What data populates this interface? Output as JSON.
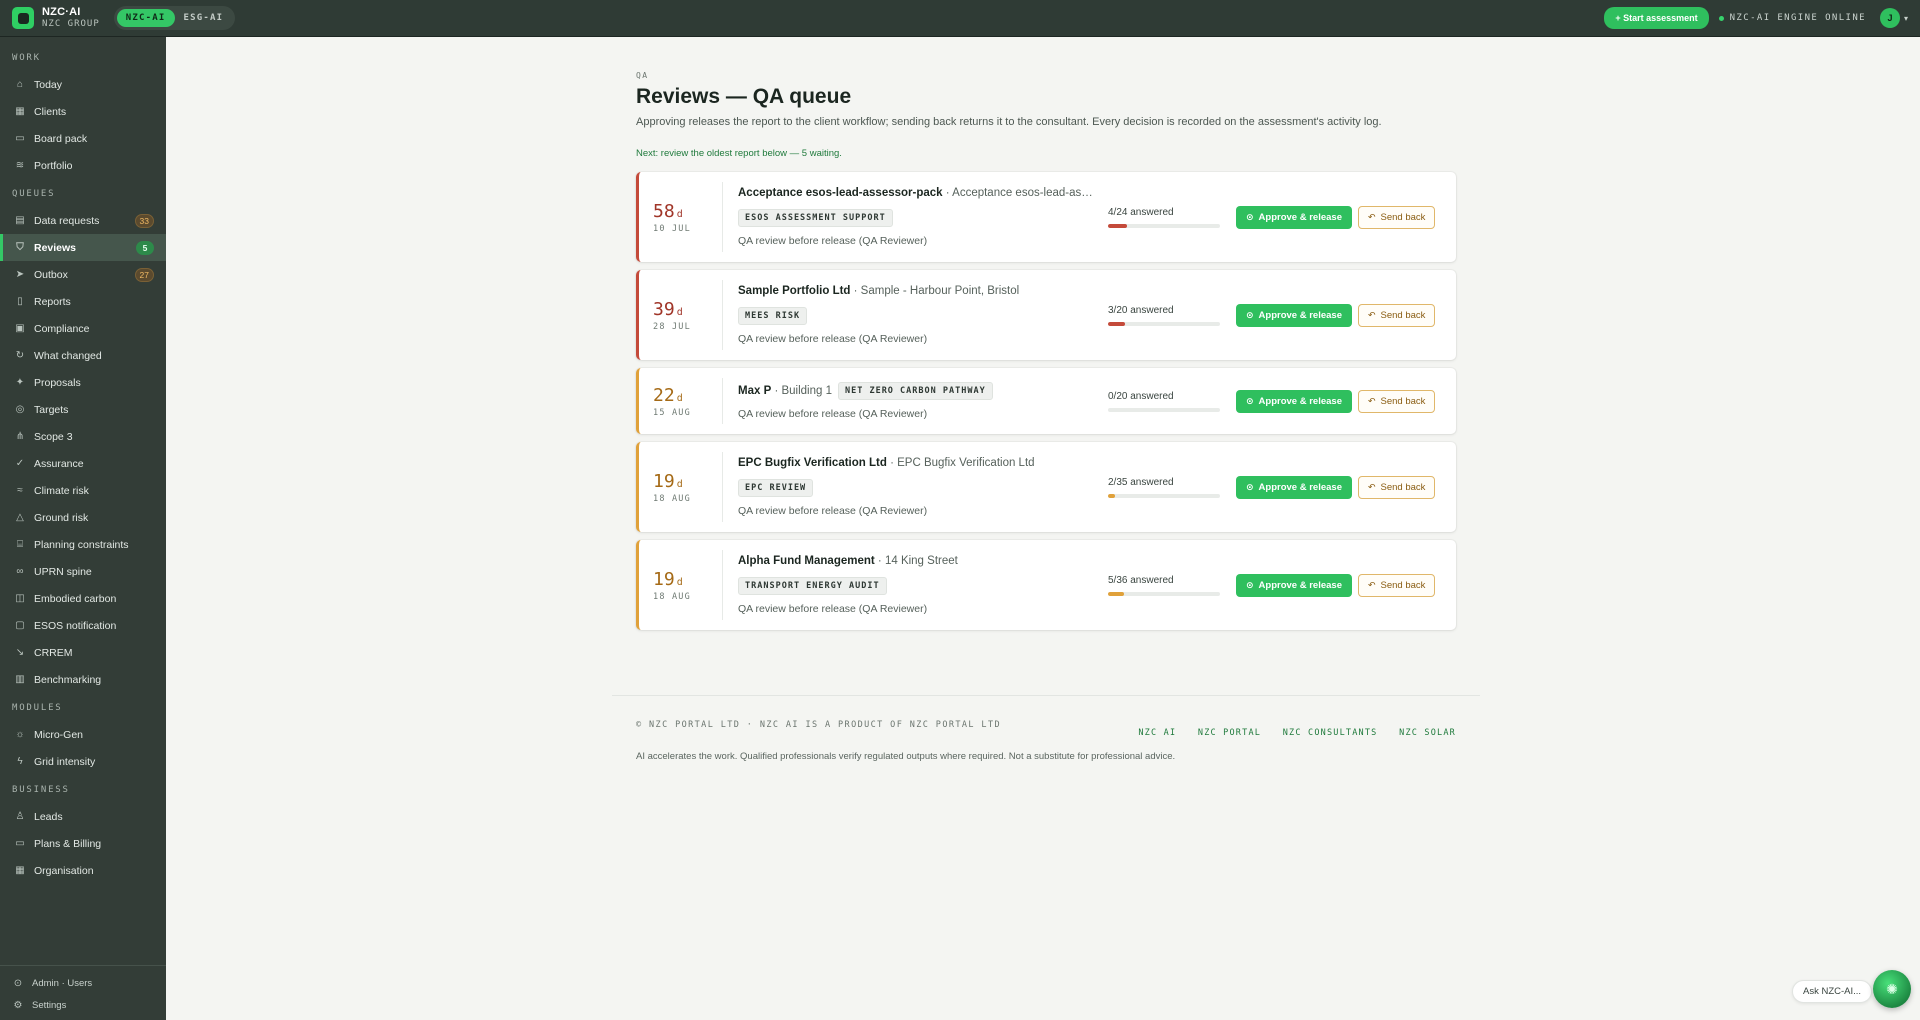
{
  "topbar": {
    "brand_name": "NZC·AI",
    "brand_sub": "NZC GROUP",
    "switch": [
      "NZC-AI",
      "ESG-AI"
    ],
    "start_label": "+ Start assessment",
    "engine_status": "NZC-AI ENGINE ONLINE",
    "avatar_initial": "J"
  },
  "sidebar": {
    "sections": [
      {
        "label": "WORK",
        "items": [
          {
            "label": "Today",
            "icon": "home-icon"
          },
          {
            "label": "Clients",
            "icon": "building-icon"
          },
          {
            "label": "Board pack",
            "icon": "monitor-icon"
          },
          {
            "label": "Portfolio",
            "icon": "layers-icon"
          }
        ]
      },
      {
        "label": "QUEUES",
        "items": [
          {
            "label": "Data requests",
            "icon": "inbox-icon",
            "badge": "33"
          },
          {
            "label": "Reviews",
            "icon": "shield-check-icon",
            "badge": "5",
            "active": true
          },
          {
            "label": "Outbox",
            "icon": "send-icon",
            "badge": "27"
          },
          {
            "label": "Reports",
            "icon": "file-icon"
          },
          {
            "label": "Compliance",
            "icon": "calendar-icon"
          },
          {
            "label": "What changed",
            "icon": "refresh-icon"
          },
          {
            "label": "Proposals",
            "icon": "sparkle-icon"
          },
          {
            "label": "Targets",
            "icon": "target-icon"
          },
          {
            "label": "Scope 3",
            "icon": "network-icon"
          },
          {
            "label": "Assurance",
            "icon": "check-circle-icon"
          },
          {
            "label": "Climate risk",
            "icon": "waves-icon"
          },
          {
            "label": "Ground risk",
            "icon": "mountain-icon"
          },
          {
            "label": "Planning constraints",
            "icon": "landmark-icon"
          },
          {
            "label": "UPRN spine",
            "icon": "link-icon"
          },
          {
            "label": "Embodied carbon",
            "icon": "box-icon"
          },
          {
            "label": "ESOS notification",
            "icon": "document-icon"
          },
          {
            "label": "CRREM",
            "icon": "trend-icon"
          },
          {
            "label": "Benchmarking",
            "icon": "bar-chart-icon"
          }
        ]
      },
      {
        "label": "MODULES",
        "items": [
          {
            "label": "Micro-Gen",
            "icon": "sun-icon"
          },
          {
            "label": "Grid intensity",
            "icon": "bolt-icon"
          }
        ]
      },
      {
        "label": "BUSINESS",
        "items": [
          {
            "label": "Leads",
            "icon": "users-icon"
          },
          {
            "label": "Plans & Billing",
            "icon": "card-icon"
          },
          {
            "label": "Organisation",
            "icon": "org-icon"
          }
        ]
      }
    ],
    "bottom": [
      {
        "label": "Admin · Users",
        "icon": "admin-icon"
      },
      {
        "label": "Settings",
        "icon": "gear-icon"
      }
    ]
  },
  "page": {
    "kicker": "QA",
    "title": "Reviews — QA queue",
    "subtitle": "Approving releases the report to the client workflow; sending back returns it to the consultant. Every decision is recorded on the assessment's activity log.",
    "next_line": "Next: review the oldest report below — 5 waiting."
  },
  "reviews": [
    {
      "age": "58",
      "unit": "d",
      "date": "10 JUL",
      "client": "Acceptance esos-lead-assessor-pack",
      "site": " · Acceptance esos-lead-ass…",
      "tag": "ESOS ASSESSMENT SUPPORT",
      "note": "QA review before release (QA Reviewer)",
      "answered": "4/24 answered",
      "progress": 0.17,
      "severity": "red"
    },
    {
      "age": "39",
      "unit": "d",
      "date": "28 JUL",
      "client": "Sample Portfolio Ltd",
      "site": " · Sample - Harbour Point, Bristol",
      "tag": "MEES RISK",
      "note": "QA review before release (QA Reviewer)",
      "answered": "3/20 answered",
      "progress": 0.15,
      "severity": "red"
    },
    {
      "age": "22",
      "unit": "d",
      "date": "15 AUG",
      "client": "Max P",
      "site": " · Building 1",
      "tag": "NET ZERO CARBON PATHWAY",
      "note": "QA review before release (QA Reviewer)",
      "answered": "0/20 answered",
      "progress": 0,
      "severity": "amber",
      "inline_tag": true
    },
    {
      "age": "19",
      "unit": "d",
      "date": "18 AUG",
      "client": "EPC Bugfix Verification Ltd",
      "site": " · EPC Bugfix Verification Ltd",
      "tag": "EPC REVIEW",
      "note": "QA review before release (QA Reviewer)",
      "answered": "2/35 answered",
      "progress": 0.06,
      "severity": "amber"
    },
    {
      "age": "19",
      "unit": "d",
      "date": "18 AUG",
      "client": "Alpha Fund Management",
      "site": " · 14 King Street",
      "tag": "TRANSPORT ENERGY AUDIT",
      "note": "QA review before release (QA Reviewer)",
      "answered": "5/36 answered",
      "progress": 0.14,
      "severity": "amber"
    }
  ],
  "actions": {
    "approve": "Approve & release",
    "send_back": "Send back"
  },
  "footer": {
    "copy": "© NZC PORTAL LTD · NZC AI IS A PRODUCT OF NZC PORTAL LTD",
    "links": [
      "NZC AI",
      "NZC PORTAL",
      "NZC CONSULTANTS",
      "NZC SOLAR"
    ],
    "disclaimer": "AI accelerates the work. Qualified professionals verify regulated outputs where required. Not a substitute for professional advice."
  },
  "assistant": {
    "label": "Ask NZC-AI..."
  },
  "colors": {
    "accent": "#2fbf5e",
    "red": "#c44a3a",
    "amber": "#e0a13a"
  }
}
